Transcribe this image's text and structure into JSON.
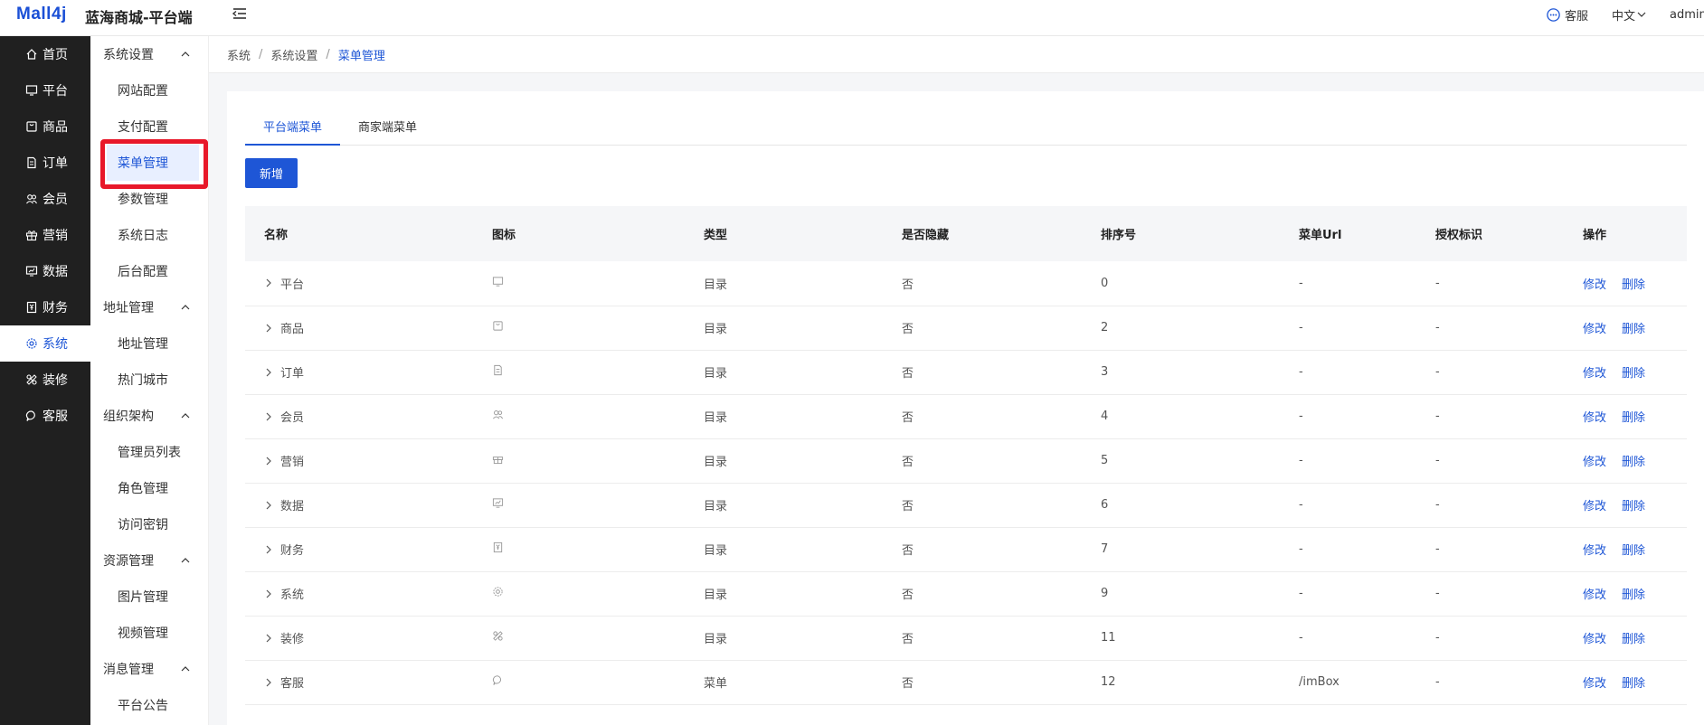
{
  "header": {
    "logo": "Mall4j",
    "title": "蓝海商城-平台端",
    "service_label": "客服",
    "language": "中文",
    "user": "admin"
  },
  "sidebar": {
    "items": [
      {
        "label": "首页",
        "icon": "home-icon"
      },
      {
        "label": "平台",
        "icon": "monitor-icon"
      },
      {
        "label": "商品",
        "icon": "bag-icon"
      },
      {
        "label": "订单",
        "icon": "document-icon"
      },
      {
        "label": "会员",
        "icon": "users-icon"
      },
      {
        "label": "营销",
        "icon": "gift-icon"
      },
      {
        "label": "数据",
        "icon": "chart-screen-icon"
      },
      {
        "label": "财务",
        "icon": "finance-icon"
      },
      {
        "label": "系统",
        "icon": "gear-icon"
      },
      {
        "label": "装修",
        "icon": "decorate-icon"
      },
      {
        "label": "客服",
        "icon": "chat-icon"
      }
    ],
    "active": "系统"
  },
  "submenu": {
    "groups": [
      {
        "label": "系统设置",
        "items": [
          "网站配置",
          "支付配置",
          "菜单管理",
          "参数管理",
          "系统日志",
          "后台配置"
        ]
      },
      {
        "label": "地址管理",
        "items": [
          "地址管理",
          "热门城市"
        ]
      },
      {
        "label": "组织架构",
        "items": [
          "管理员列表",
          "角色管理",
          "访问密钥"
        ]
      },
      {
        "label": "资源管理",
        "items": [
          "图片管理",
          "视频管理"
        ]
      },
      {
        "label": "消息管理",
        "items": [
          "平台公告"
        ]
      }
    ],
    "active": "菜单管理"
  },
  "breadcrumb": [
    "系统",
    "系统设置",
    "菜单管理"
  ],
  "tabs": [
    {
      "label": "平台端菜单",
      "active": true
    },
    {
      "label": "商家端菜单",
      "active": false
    }
  ],
  "add_button": "新增",
  "table": {
    "headers": [
      "名称",
      "图标",
      "类型",
      "是否隐藏",
      "排序号",
      "菜单Url",
      "授权标识",
      "操作"
    ],
    "actions": {
      "edit": "修改",
      "delete": "删除"
    },
    "rows": [
      {
        "name": "平台",
        "icon": "monitor-icon",
        "type": "目录",
        "hidden": "否",
        "order": "0",
        "url": "-",
        "perm": "-"
      },
      {
        "name": "商品",
        "icon": "bag-icon",
        "type": "目录",
        "hidden": "否",
        "order": "2",
        "url": "-",
        "perm": "-"
      },
      {
        "name": "订单",
        "icon": "document-icon",
        "type": "目录",
        "hidden": "否",
        "order": "3",
        "url": "-",
        "perm": "-"
      },
      {
        "name": "会员",
        "icon": "users-icon",
        "type": "目录",
        "hidden": "否",
        "order": "4",
        "url": "-",
        "perm": "-"
      },
      {
        "name": "营销",
        "icon": "gift-icon",
        "type": "目录",
        "hidden": "否",
        "order": "5",
        "url": "-",
        "perm": "-"
      },
      {
        "name": "数据",
        "icon": "chart-screen-icon",
        "type": "目录",
        "hidden": "否",
        "order": "6",
        "url": "-",
        "perm": "-"
      },
      {
        "name": "财务",
        "icon": "finance-icon",
        "type": "目录",
        "hidden": "否",
        "order": "7",
        "url": "-",
        "perm": "-"
      },
      {
        "name": "系统",
        "icon": "gear-icon",
        "type": "目录",
        "hidden": "否",
        "order": "9",
        "url": "-",
        "perm": "-"
      },
      {
        "name": "装修",
        "icon": "decorate-icon",
        "type": "目录",
        "hidden": "否",
        "order": "11",
        "url": "-",
        "perm": "-"
      },
      {
        "name": "客服",
        "icon": "chat-icon",
        "type": "菜单",
        "hidden": "否",
        "order": "12",
        "url": "/imBox",
        "perm": "-"
      }
    ]
  }
}
